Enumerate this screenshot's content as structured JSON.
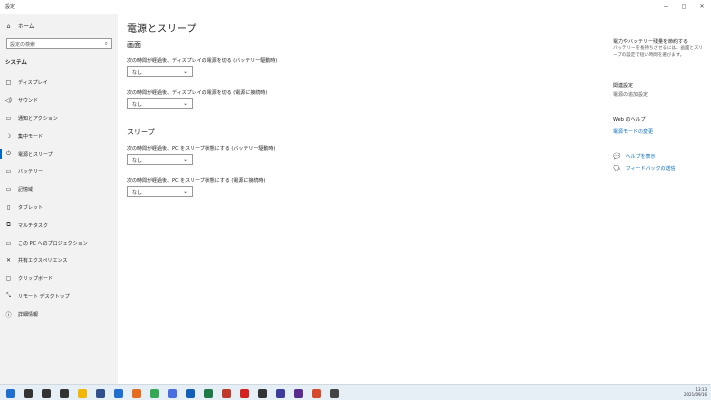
{
  "window": {
    "title": "設定",
    "controls": [
      "−",
      "◻",
      "✕"
    ]
  },
  "sidebar": {
    "home_label": "ホーム",
    "search_placeholder": "設定の検索",
    "section_title": "システム",
    "items": [
      {
        "label": "ディスプレイ",
        "icon": "□"
      },
      {
        "label": "サウンド",
        "icon": "◁)"
      },
      {
        "label": "通知とアクション",
        "icon": "▭"
      },
      {
        "label": "集中モード",
        "icon": "☽"
      },
      {
        "label": "電源とスリープ",
        "icon": "⏻",
        "active": true
      },
      {
        "label": "バッテリー",
        "icon": "▭"
      },
      {
        "label": "記憶域",
        "icon": "▭"
      },
      {
        "label": "タブレット",
        "icon": "▯"
      },
      {
        "label": "マルチタスク",
        "icon": "⧉"
      },
      {
        "label": "この PC へのプロジェクション",
        "icon": "▭"
      },
      {
        "label": "共有エクスペリエンス",
        "icon": "✕"
      },
      {
        "label": "クリップボード",
        "icon": "▢"
      },
      {
        "label": "リモート デスクトップ",
        "icon": "⤡"
      },
      {
        "label": "詳細情報",
        "icon": "ⓘ"
      }
    ]
  },
  "main": {
    "title": "電源とスリープ",
    "screen": {
      "heading": "画面",
      "battery_label": "次の時間が経過後、ディスプレイの電源を切る (バッテリー駆動時)",
      "battery_value": "なし",
      "plugged_label": "次の時間が経過後、ディスプレイの電源を切る (電源に接続時)",
      "plugged_value": "なし"
    },
    "sleep": {
      "heading": "スリープ",
      "battery_label": "次の時間が経過後、PC をスリープ状態にする (バッテリー駆動時)",
      "battery_value": "なし",
      "plugged_label": "次の時間が経過後、PC をスリープ状態にする (電源に接続時)",
      "plugged_value": "なし"
    }
  },
  "right_panel": {
    "tip_title": "電力やバッテリー残量を節約する",
    "tip_text_1": "バッテリーを長持ちさせるには、画面とスリ",
    "tip_text_2": "ープの設定で短い時間を選びます。",
    "related_title": "関連設定",
    "related_link": "電源の追加設定",
    "web_help_title": "Web のヘルプ",
    "web_help_link": "電源モードの変更",
    "help_link": "ヘルプを表示",
    "feedback_link": "フィードバックの送信"
  },
  "taskbar": {
    "time": "13:13",
    "date": "2021/09/16",
    "icons": [
      {
        "name": "windows-start-icon",
        "color": "#1f6fd1"
      },
      {
        "name": "search-icon",
        "color": "#333333"
      },
      {
        "name": "task-view-icon",
        "color": "#333333"
      },
      {
        "name": "widgets-icon",
        "color": "#333333"
      },
      {
        "name": "file-explorer-icon",
        "color": "#f2b705"
      },
      {
        "name": "store-icon",
        "color": "#2f4f8f"
      },
      {
        "name": "mail-icon",
        "color": "#1f6fd1"
      },
      {
        "name": "firefox-icon",
        "color": "#e66b1e"
      },
      {
        "name": "chrome-icon",
        "color": "#34a853"
      },
      {
        "name": "chat-icon",
        "color": "#4a6ee0"
      },
      {
        "name": "outlook-icon",
        "color": "#0f5fb8"
      },
      {
        "name": "excel-icon",
        "color": "#1d7a45"
      },
      {
        "name": "paint-icon",
        "color": "#c0392b"
      },
      {
        "name": "record-icon",
        "color": "#d62020"
      },
      {
        "name": "clock-app-icon",
        "color": "#333333"
      },
      {
        "name": "calculator-icon",
        "color": "#3c3c9c"
      },
      {
        "name": "editor-icon",
        "color": "#5b2c8f"
      },
      {
        "name": "chrome-alt-icon",
        "color": "#d64a2b"
      },
      {
        "name": "settings-icon",
        "color": "#444444"
      }
    ]
  }
}
